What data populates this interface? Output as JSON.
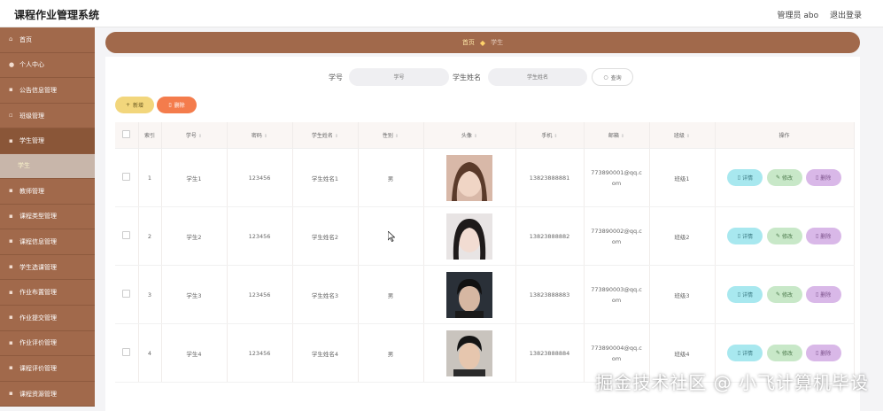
{
  "app": {
    "title": "课程作业管理系统"
  },
  "topbar": {
    "role_user": "管理员 abo",
    "logout": "退出登录"
  },
  "sidebar": {
    "items": [
      {
        "label": "首页",
        "icon": "home-icon"
      },
      {
        "label": "个人中心",
        "icon": "user-icon"
      },
      {
        "label": "公告信息管理",
        "icon": "notice-icon"
      },
      {
        "label": "班级管理",
        "icon": "class-icon"
      },
      {
        "label": "学生管理",
        "icon": "student-icon"
      },
      {
        "label": "教师管理",
        "icon": "teacher-icon"
      },
      {
        "label": "课程类型管理",
        "icon": "course-type-icon"
      },
      {
        "label": "课程信息管理",
        "icon": "course-icon"
      },
      {
        "label": "学生选课管理",
        "icon": "select-course-icon"
      },
      {
        "label": "作业布置管理",
        "icon": "assign-icon"
      },
      {
        "label": "作业提交管理",
        "icon": "submit-icon"
      },
      {
        "label": "作业评价管理",
        "icon": "review-icon"
      },
      {
        "label": "课程评价管理",
        "icon": "rating-icon"
      },
      {
        "label": "课程资源管理",
        "icon": "resource-icon"
      }
    ],
    "sub_item": "学生"
  },
  "breadcrumb": {
    "home": "首页",
    "current": "学生"
  },
  "search": {
    "label_no": "学号",
    "placeholder_no": "学号",
    "label_name": "学生姓名",
    "placeholder_name": "学生姓名",
    "button": "查询"
  },
  "actions": {
    "add": "新增",
    "delete": "删除"
  },
  "table": {
    "headers": [
      "索引",
      "学号",
      "密码",
      "学生姓名",
      "性别",
      "头像",
      "手机",
      "邮箱",
      "班级",
      "操作"
    ],
    "row_actions": {
      "detail": "详情",
      "edit": "修改",
      "remove": "删除"
    },
    "rows": [
      {
        "idx": "1",
        "no": "学生1",
        "pwd": "123456",
        "name": "学生姓名1",
        "gender": "男",
        "phone": "13823888881",
        "email_a": "773890001@qq.c",
        "email_b": "om",
        "cls": "班级1"
      },
      {
        "idx": "2",
        "no": "学生2",
        "pwd": "123456",
        "name": "学生姓名2",
        "gender": "",
        "phone": "13823888882",
        "email_a": "773890002@qq.c",
        "email_b": "om",
        "cls": "班级2"
      },
      {
        "idx": "3",
        "no": "学生3",
        "pwd": "123456",
        "name": "学生姓名3",
        "gender": "男",
        "phone": "13823888883",
        "email_a": "773890003@qq.c",
        "email_b": "om",
        "cls": "班级3"
      },
      {
        "idx": "4",
        "no": "学生4",
        "pwd": "123456",
        "name": "学生姓名4",
        "gender": "男",
        "phone": "13823888884",
        "email_a": "773890004@qq.c",
        "email_b": "om",
        "cls": "班级4"
      }
    ]
  },
  "watermark": "掘金技术社区 @ 小飞计算机毕设",
  "colors": {
    "sidebar": "#a1694b",
    "add": "#f2d67c",
    "delete": "#f47c4c",
    "detail": "#a8e8ef",
    "edit": "#c8e8c8",
    "remove": "#d9b8e8"
  }
}
